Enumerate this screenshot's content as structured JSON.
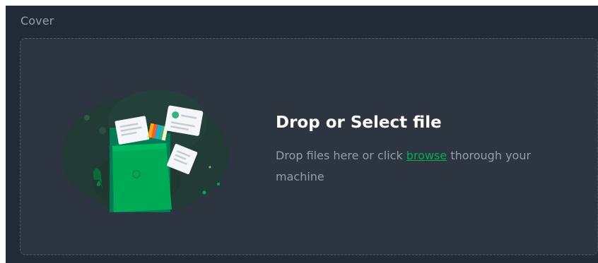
{
  "field": {
    "label": "Cover"
  },
  "dropzone": {
    "title": "Drop or Select file",
    "desc_prefix": "Drop files here or click ",
    "link_label": "browse",
    "desc_suffix": " thorough your machine",
    "illustration_icon": "upload-folder-illustration"
  },
  "colors": {
    "background": "#212b36",
    "dropzone": "#2c3540",
    "accent": "#00ab55",
    "text_secondary": "#919eab",
    "text_primary": "#ffffff"
  }
}
